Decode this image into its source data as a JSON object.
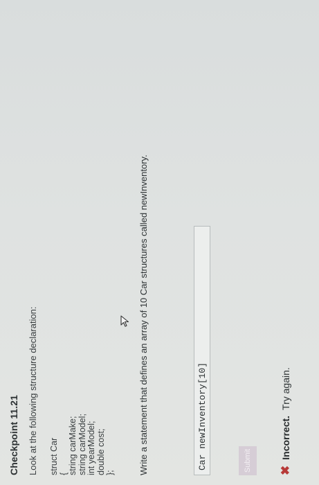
{
  "checkpoint": {
    "title": "Checkpoint 11.21",
    "prompt": "Look at the following structure declaration:",
    "code_lines": [
      "struct Car",
      "{",
      "string carMake;",
      "string carModel;",
      "int yearModel;",
      "double cost;",
      "};"
    ],
    "question": "Write a statement that defines an array of 10 Car structures called newInventory."
  },
  "answer": {
    "value": "Car newInventory[10]"
  },
  "submit": {
    "label": "Submit"
  },
  "feedback": {
    "icon": "x-icon",
    "status": "Incorrect.",
    "message": "Try again."
  },
  "colors": {
    "error": "#b73a38",
    "submit_disabled_bg": "#d6cdd6"
  }
}
